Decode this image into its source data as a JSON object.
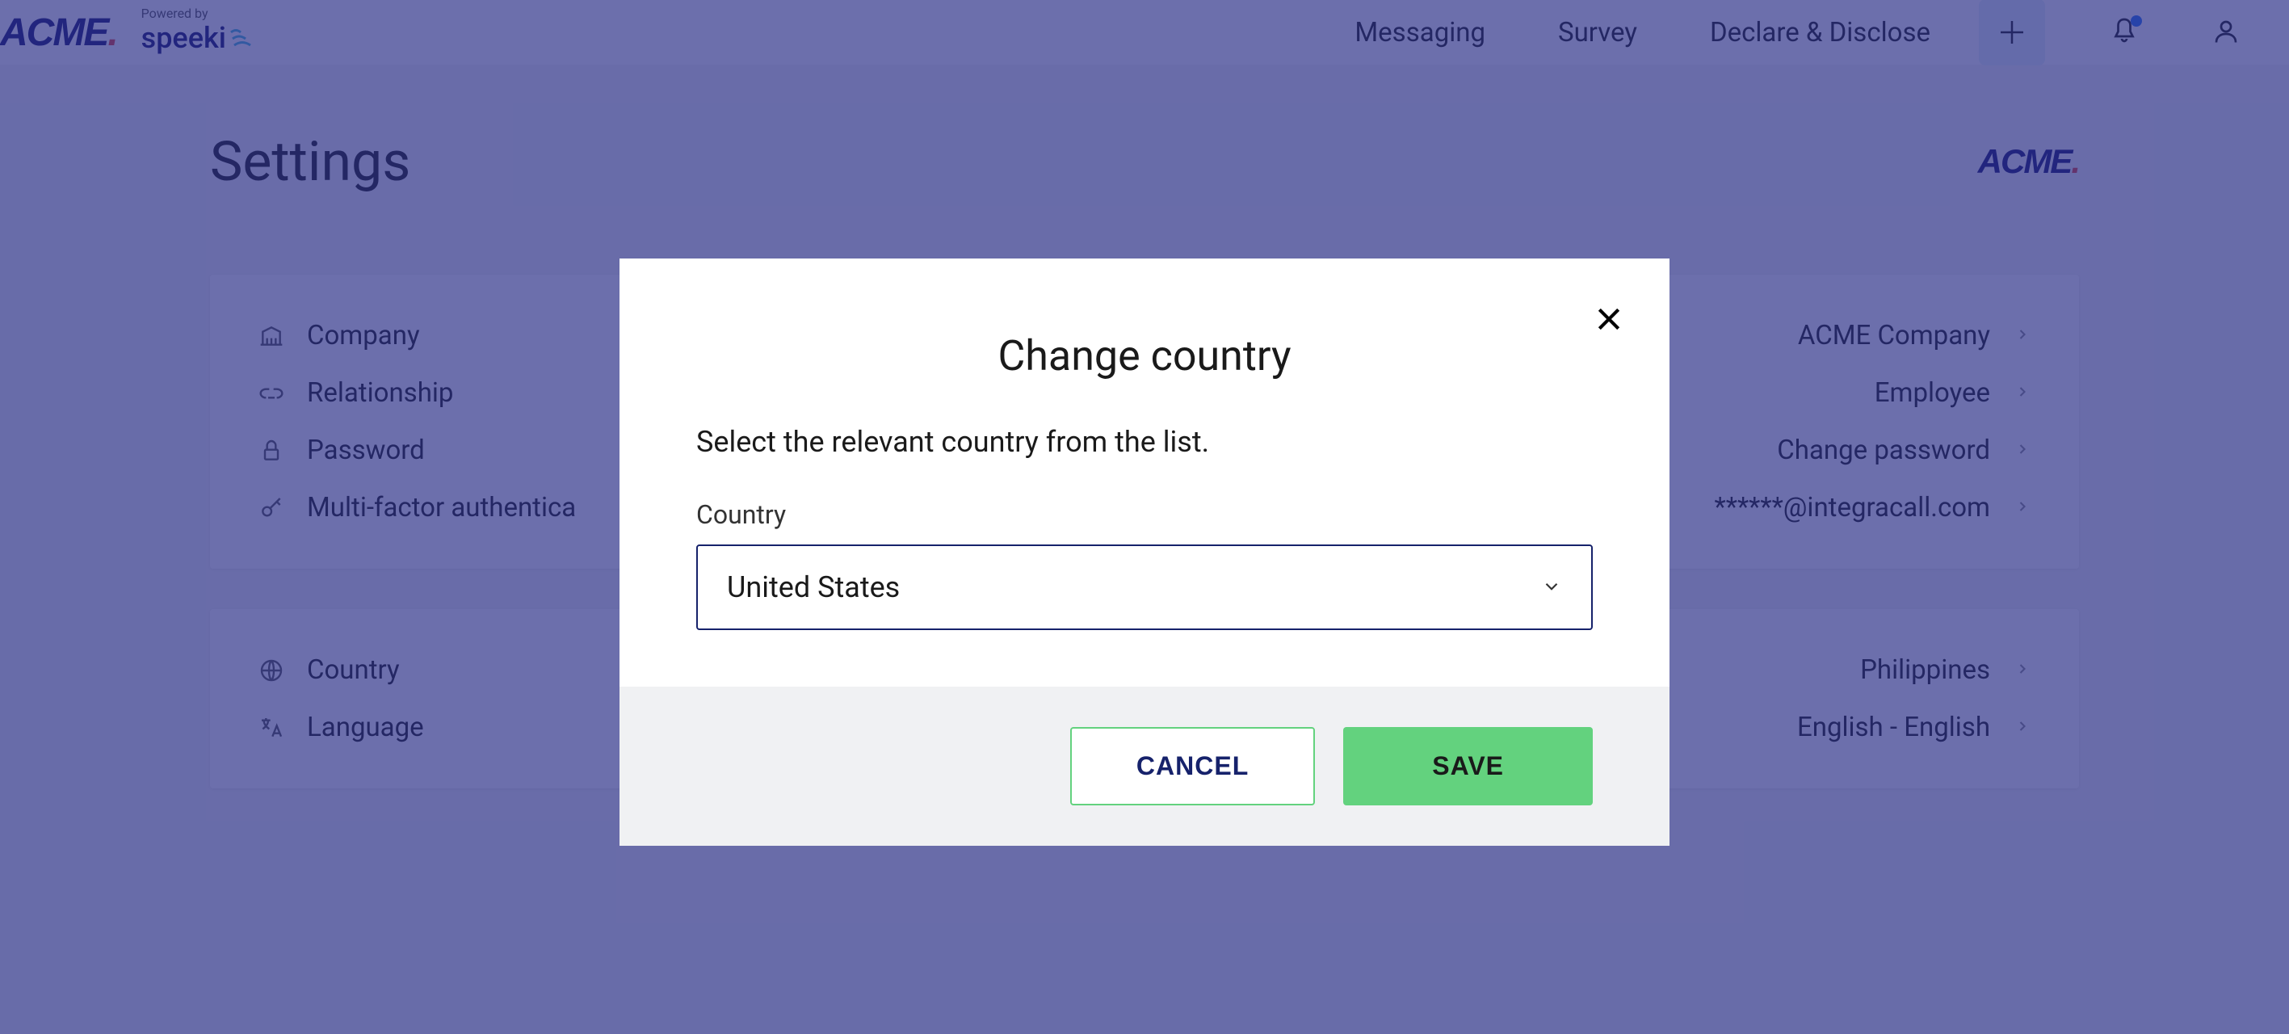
{
  "header": {
    "logo_text": "ACME",
    "logo_dot": ".",
    "powered_by": "Powered by",
    "speeki": "speeki",
    "nav": {
      "messaging": "Messaging",
      "survey": "Survey",
      "declare": "Declare & Disclose"
    }
  },
  "page": {
    "title": "Settings",
    "content_logo": "ACME"
  },
  "settings": {
    "section1": [
      {
        "icon": "company",
        "label": "Company",
        "value": "ACME Company"
      },
      {
        "icon": "relationship",
        "label": "Relationship",
        "value": "Employee"
      },
      {
        "icon": "password",
        "label": "Password",
        "value": "Change password"
      },
      {
        "icon": "mfa",
        "label": "Multi-factor authentica",
        "value": "******@integracall.com"
      }
    ],
    "section2": [
      {
        "icon": "country",
        "label": "Country",
        "value": "Philippines"
      },
      {
        "icon": "language",
        "label": "Language",
        "value": "English - English"
      }
    ]
  },
  "modal": {
    "title": "Change country",
    "subtitle": "Select the relevant country from the list.",
    "field_label": "Country",
    "selected_value": "United States",
    "cancel": "CANCEL",
    "save": "SAVE"
  }
}
